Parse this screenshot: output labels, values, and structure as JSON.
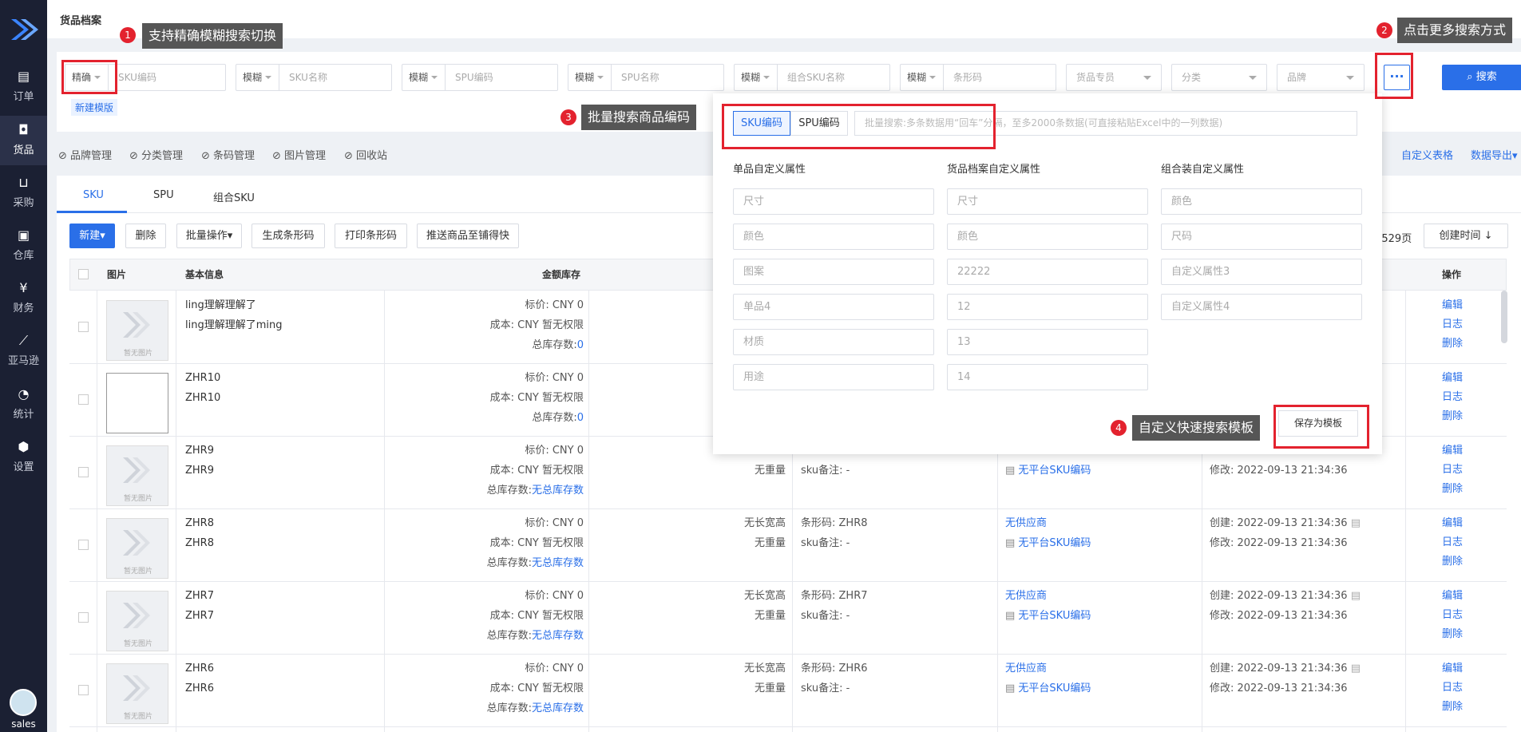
{
  "sidebar": {
    "items": [
      {
        "label": "订单",
        "icon": "clipboard-icon"
      },
      {
        "label": "货品",
        "icon": "bag-icon"
      },
      {
        "label": "采购",
        "icon": "basket-icon"
      },
      {
        "label": "仓库",
        "icon": "warehouse-icon"
      },
      {
        "label": "财务",
        "icon": "yen-icon"
      },
      {
        "label": "亚马逊",
        "icon": "chart-line-icon"
      },
      {
        "label": "统计",
        "icon": "pie-icon"
      },
      {
        "label": "设置",
        "icon": "gear-icon"
      }
    ],
    "user": "sales"
  },
  "page_title": "货品档案",
  "search": {
    "f1": {
      "mode": "精确",
      "ph": "SKU编码"
    },
    "f2": {
      "mode": "模糊",
      "ph": "SKU名称"
    },
    "f3": {
      "mode": "模糊",
      "ph": "SPU编码"
    },
    "f4": {
      "mode": "模糊",
      "ph": "SPU名称"
    },
    "f5": {
      "mode": "模糊",
      "ph": "组合SKU名称"
    },
    "f6": {
      "mode": "模糊",
      "ph": "条形码"
    },
    "s1": "货品专员",
    "s2": "分类",
    "s3": "品牌",
    "more": "···",
    "search_btn": "搜索",
    "new_template": "新建模版"
  },
  "annotations": {
    "t1": "支持精确模糊搜索切换",
    "t2": "点击更多搜索方式",
    "t3": "批量搜索商品编码",
    "t4": "自定义快速搜索模板",
    "n1": "1",
    "n2": "2",
    "n3": "3",
    "n4": "4"
  },
  "links": [
    "品牌管理",
    "分类管理",
    "条码管理",
    "图片管理",
    "回收站"
  ],
  "right_links": {
    "custom_table": "自定义表格",
    "export": "数据导出"
  },
  "tabs": [
    "SKU",
    "SPU",
    "组合SKU"
  ],
  "toolbar": {
    "new": "新建",
    "delete": "删除",
    "batch": "批量操作",
    "gen_barcode": "生成条形码",
    "print_barcode": "打印条形码",
    "push": "推送商品至铺得快",
    "pages": "/529页",
    "sort": "创建时间 ↓"
  },
  "headers": {
    "img": "图片",
    "basic": "基本信息",
    "money": "金额库存",
    "ops": "操作"
  },
  "panel": {
    "tab_sku": "SKU编码",
    "tab_spu": "SPU编码",
    "batch_ph": "批量搜索:多条数据用“回车”分隔，至多2000条数据(可直接粘贴Excel中的一列数据)",
    "col1": {
      "title": "单品自定义属性",
      "fields": [
        "尺寸",
        "颜色",
        "图案",
        "单品4",
        "材质",
        "用途"
      ]
    },
    "col2": {
      "title": "货品档案自定义属性",
      "fields": [
        "尺寸",
        "颜色",
        "22222",
        "12",
        "13",
        "14"
      ]
    },
    "col3": {
      "title": "组合装自定义属性",
      "fields": [
        "颜色",
        "尺码",
        "自定义属性3",
        "自定义属性4"
      ]
    },
    "save": "保存为模板"
  },
  "rows": [
    {
      "n1": "ling理解理解了",
      "n2": "ling理解理解了ming",
      "price": "标价: CNY 0",
      "cost": "成本: CNY 暂无权限",
      "stock_l": "总库存数:",
      "stock_v": "0",
      "img": "none"
    },
    {
      "n1": "ZHR10",
      "n2": "ZHR10",
      "price": "标价: CNY 0",
      "cost": "成本: CNY 暂无权限",
      "stock_l": "总库存数:",
      "stock_v": "0",
      "img": "broken"
    },
    {
      "n1": "ZHR9",
      "n2": "ZHR9",
      "price": "标价: CNY 0",
      "cost": "成本: CNY 暂无权限",
      "stock_l": "总库存数:",
      "stock_v": "无总库存数",
      "size": "",
      "weight": "无重量",
      "barcode": "",
      "remark": "sku备注: -",
      "supplier": "",
      "platform": "无平台SKU编码",
      "created": "",
      "modified": "修改: 2022-09-13 21:34:36",
      "img": "none"
    },
    {
      "n1": "ZHR8",
      "n2": "ZHR8",
      "price": "标价: CNY 0",
      "cost": "成本: CNY 暂无权限",
      "stock_l": "总库存数:",
      "stock_v": "无总库存数",
      "size": "无长宽高",
      "weight": "无重量",
      "barcode": "条形码: ZHR8",
      "remark": "sku备注: -",
      "supplier": "无供应商",
      "platform": "无平台SKU编码",
      "created": "创建: 2022-09-13 21:34:36",
      "modified": "修改: 2022-09-13 21:34:36",
      "img": "none"
    },
    {
      "n1": "ZHR7",
      "n2": "ZHR7",
      "price": "标价: CNY 0",
      "cost": "成本: CNY 暂无权限",
      "stock_l": "总库存数:",
      "stock_v": "无总库存数",
      "size": "无长宽高",
      "weight": "无重量",
      "barcode": "条形码: ZHR7",
      "remark": "sku备注: -",
      "supplier": "无供应商",
      "platform": "无平台SKU编码",
      "created": "创建: 2022-09-13 21:34:36",
      "modified": "修改: 2022-09-13 21:34:36",
      "img": "none"
    },
    {
      "n1": "ZHR6",
      "n2": "ZHR6",
      "price": "标价: CNY 0",
      "cost": "成本: CNY 暂无权限",
      "stock_l": "总库存数:",
      "stock_v": "无总库存数",
      "size": "无长宽高",
      "weight": "无重量",
      "barcode": "条形码: ZHR6",
      "remark": "sku备注: -",
      "supplier": "无供应商",
      "platform": "无平台SKU编码",
      "created": "创建: 2022-09-13 21:34:36",
      "modified": "修改: 2022-09-13 21:34:36",
      "img": "none"
    }
  ],
  "ops": {
    "edit": "编辑",
    "log": "日志",
    "del": "删除"
  },
  "no_image": "暂无图片",
  "colors": {
    "sidebar": "#1b2033",
    "accent": "#2a6fe8",
    "annotation": "#e3222e"
  }
}
